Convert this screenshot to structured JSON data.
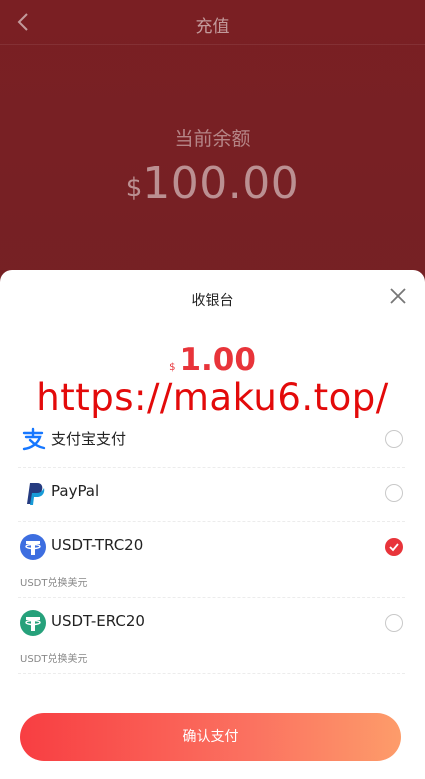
{
  "header": {
    "title": "充值",
    "back_icon": "chevron-left-icon"
  },
  "balance": {
    "label": "当前余额",
    "currency": "$",
    "amount": "100.00"
  },
  "checkout": {
    "title": "收银台",
    "close_icon": "close-icon",
    "currency": "$",
    "amount": "1.00",
    "watermark": "https://maku6.top/"
  },
  "methods": [
    {
      "name": "支付宝支付",
      "icon": "alipay-icon",
      "sub": "",
      "selected": false
    },
    {
      "name": "PayPal",
      "icon": "paypal-icon",
      "sub": "",
      "selected": false
    },
    {
      "name": "USDT-TRC20",
      "icon": "tether-icon",
      "sub": "USDT兑换美元",
      "selected": true
    },
    {
      "name": "USDT-ERC20",
      "icon": "tether-icon",
      "sub": "USDT兑换美元",
      "selected": false
    }
  ],
  "confirm_label": "确认支付",
  "colors": {
    "accent": "#e8343a",
    "alipay": "#1677ff",
    "paypal_dark": "#253b80",
    "paypal_light": "#179bd7",
    "trc20": "#3d6ee0",
    "erc20": "#26a17b"
  }
}
